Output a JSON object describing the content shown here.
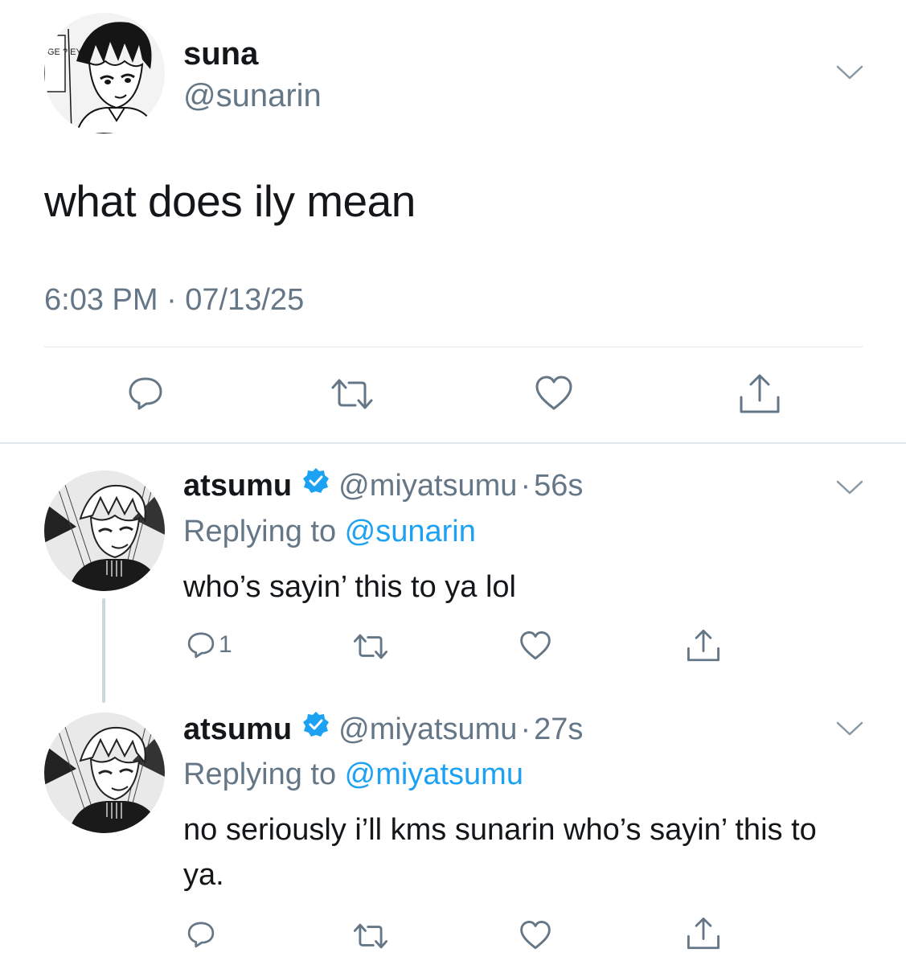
{
  "main_tweet": {
    "display_name": "suna",
    "handle": "@sunarin",
    "text": "what does ily mean",
    "timestamp": "6:03 PM · 07/13/25",
    "avatar_caption": "GE ? EY",
    "avatar_icon": "manga-avatar-suna",
    "actions": [
      "reply-icon",
      "retweet-icon",
      "like-icon",
      "share-icon"
    ]
  },
  "replies": [
    {
      "display_name": "atsumu",
      "verified": true,
      "handle": "@miyatsumu",
      "separator": "·",
      "time_ago": "56s",
      "replying_prefix": "Replying to ",
      "replying_to": "@sunarin",
      "text": "who’s sayin’ this to ya lol",
      "reply_count": "1",
      "avatar_icon": "manga-avatar-atsumu"
    },
    {
      "display_name": "atsumu",
      "verified": true,
      "handle": "@miyatsumu",
      "separator": "·",
      "time_ago": "27s",
      "replying_prefix": "Replying to ",
      "replying_to": "@miyatsumu",
      "text": "no seriously i’ll kms sunarin who’s sayin’ this to ya.",
      "reply_count": "",
      "avatar_icon": "manga-avatar-atsumu"
    }
  ],
  "colors": {
    "text": "#14171a",
    "secondary": "#657786",
    "link": "#1da1f2",
    "divider": "#e1e8ed",
    "icon": "#657786"
  }
}
